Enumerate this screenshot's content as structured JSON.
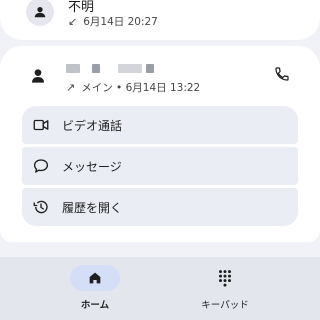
{
  "recent_top": {
    "name": "不明",
    "meta": "6月14日 20:27"
  },
  "recent_main": {
    "meta": "メイン • 6月14日 13:22"
  },
  "actions": [
    {
      "label": "ビデオ通話",
      "icon": "video-icon"
    },
    {
      "label": "メッセージ",
      "icon": "message-icon"
    },
    {
      "label": "履歴を開く",
      "icon": "history-icon"
    }
  ],
  "nav": {
    "home": "ホーム",
    "keypad": "キーパッド"
  },
  "colors": {
    "background": "#f1f2f8",
    "card": "#ffffff",
    "action_bg": "#ebedf5",
    "nav_bg": "#e4e6ee",
    "nav_active_pill": "#d5def7"
  }
}
